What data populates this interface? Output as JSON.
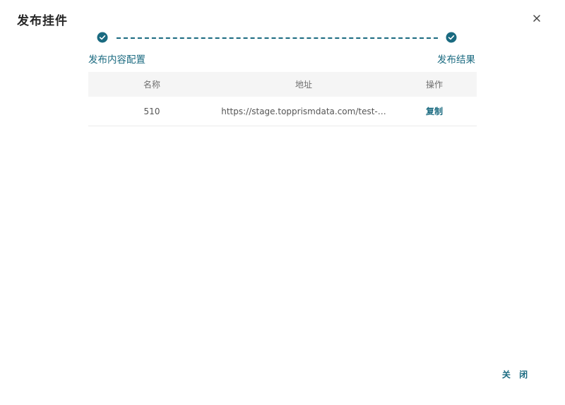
{
  "dialog": {
    "title": "发布挂件",
    "footer_close_label": "关 闭"
  },
  "steps": [
    {
      "label": "发布内容配置",
      "status": "done"
    },
    {
      "label": "发布结果",
      "status": "done"
    }
  ],
  "colors": {
    "accent": "#1a6a80"
  },
  "table": {
    "headers": [
      "名称",
      "地址",
      "操作"
    ],
    "rows": [
      {
        "name": "510",
        "address": "https://stage.topprismdata.com/test-…",
        "action": "复制"
      }
    ]
  }
}
